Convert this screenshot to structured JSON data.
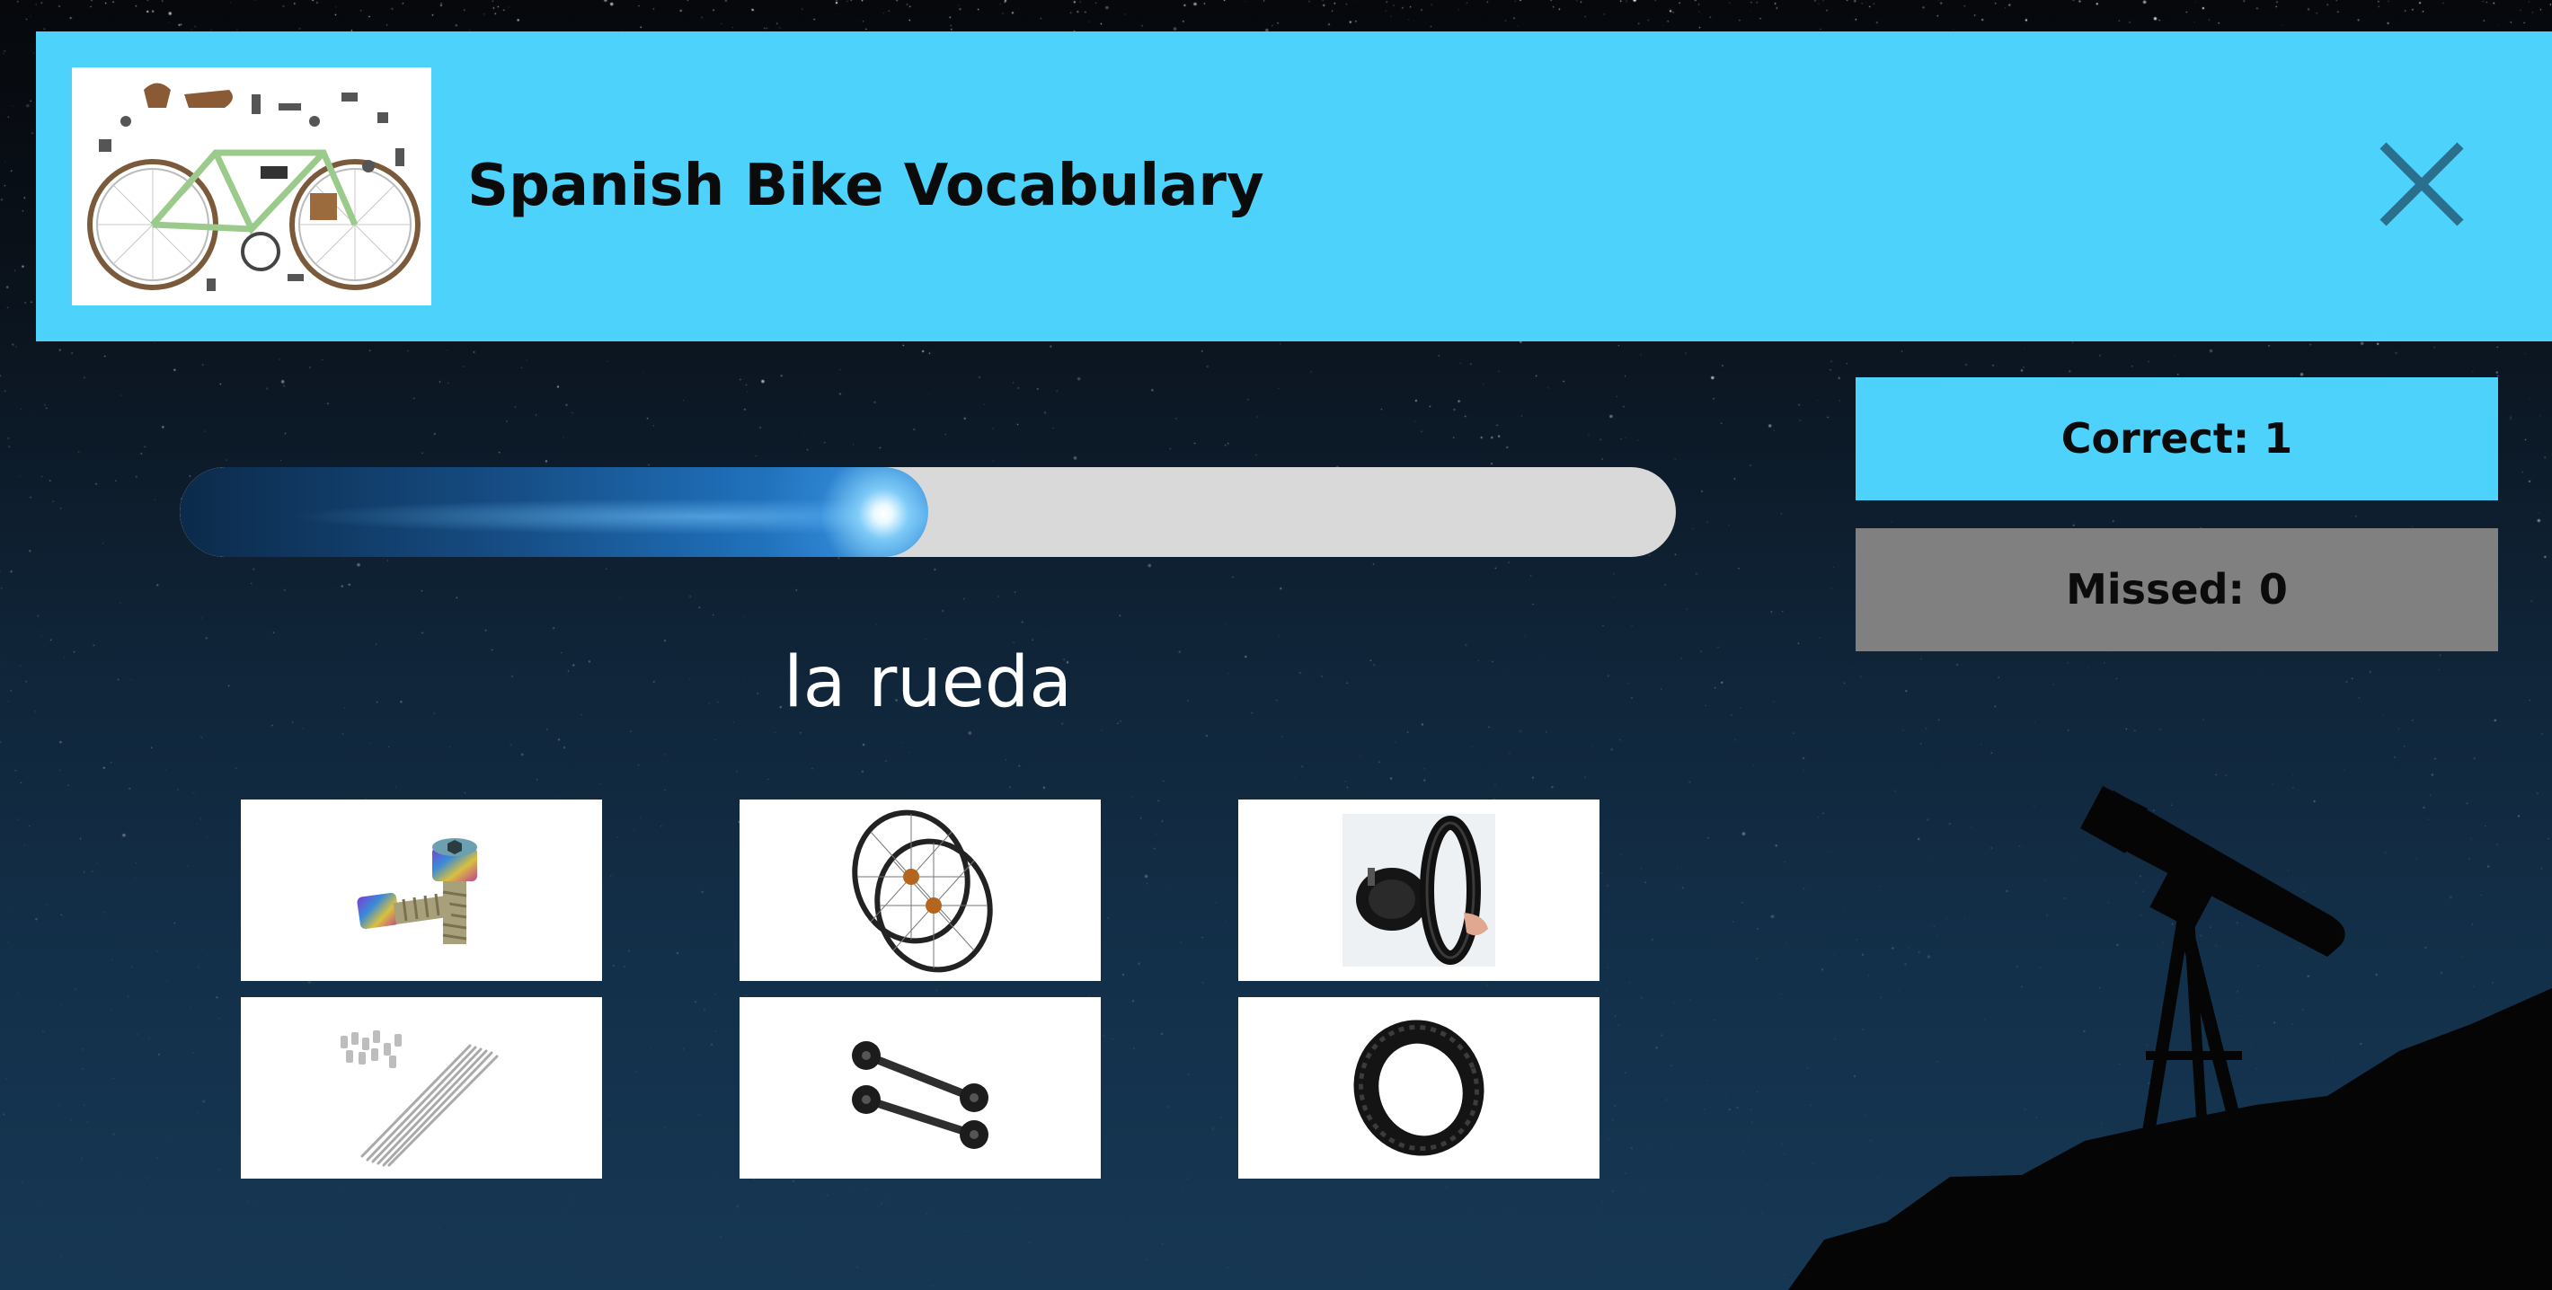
{
  "header": {
    "title": "Spanish Bike Vocabulary",
    "thumbnail_icon": "bike-parts-flatlay",
    "close_icon": "close-icon",
    "background_color": "#4dd2fb"
  },
  "progress": {
    "value": 0.5
  },
  "prompt": {
    "word": "la rueda"
  },
  "choices": [
    {
      "icon": "bolts-image"
    },
    {
      "icon": "wheels-image"
    },
    {
      "icon": "inner-tube-image"
    },
    {
      "icon": "spokes-image"
    },
    {
      "icon": "axles-image"
    },
    {
      "icon": "tire-image"
    }
  ],
  "score": {
    "correct_label": "Correct: 1",
    "missed_label": "Missed: 0",
    "correct_color": "#4dd2fb",
    "missed_color": "#808080"
  }
}
